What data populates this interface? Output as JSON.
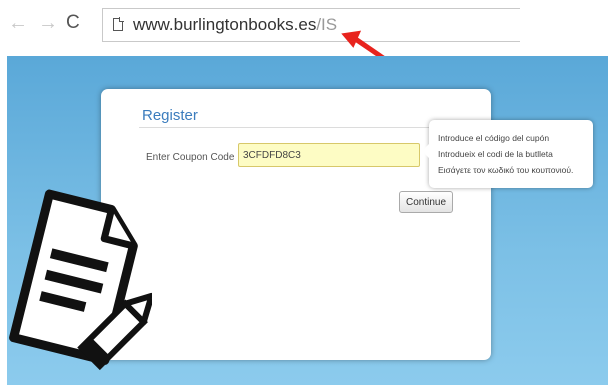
{
  "browser": {
    "url_domain": "www.burlingtonbooks.es",
    "url_path": "/IS",
    "back_glyph": "←",
    "forward_glyph": "→",
    "reload_glyph": "C"
  },
  "annotation": {
    "arrow_icon": "red-arrow-icon",
    "arrow_color": "#e8231d"
  },
  "dialog": {
    "title": "Register",
    "coupon_label": "Enter Coupon Code",
    "coupon_value": "3CFDFD8C3",
    "continue_label": "Continue"
  },
  "tooltip": {
    "lines": [
      "Introduce el código del cupón",
      "Introdueix el codi de la butlleta",
      "Εισάγετε τον κωδικό του κουπονιού."
    ]
  },
  "decoration": {
    "icon": "document-with-pencil-icon"
  },
  "colors": {
    "background": "#6fb7e2",
    "title": "#3b7cbd",
    "input_bg": "#fdfcc4"
  }
}
